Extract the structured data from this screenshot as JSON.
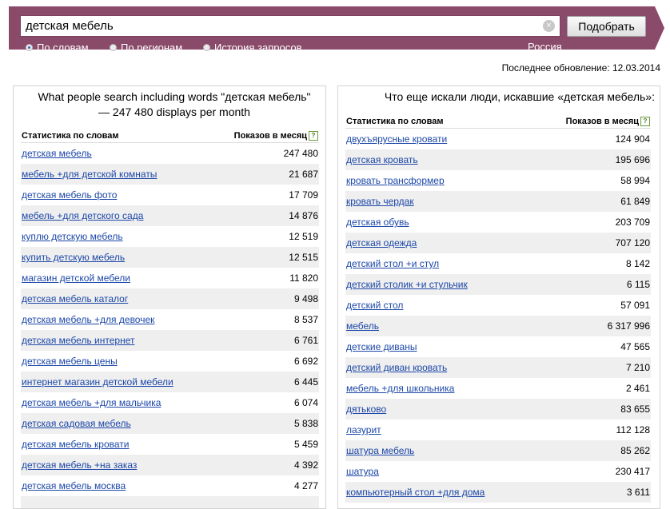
{
  "search": {
    "value": "детская мебель",
    "clear_label": "×",
    "submit_label": "Подобрать"
  },
  "modes": [
    {
      "label": "По словам",
      "checked": true
    },
    {
      "label": "По регионам",
      "checked": false
    },
    {
      "label": "История запросов",
      "checked": false
    }
  ],
  "region": "Россия",
  "updated": "Последнее обновление: 12.03.2014",
  "left_panel": {
    "title": "What people search including words \"детская мебель\" — 247 480 displays per month",
    "col_words": "Статистика по словам",
    "col_count": "Показов в месяц",
    "help": "?",
    "rows": [
      {
        "q": "детская мебель",
        "n": "247 480"
      },
      {
        "q": "мебель +для детской комнаты",
        "n": "21 687"
      },
      {
        "q": "детская мебель фото",
        "n": "17 709"
      },
      {
        "q": "мебель +для детского сада",
        "n": "14 876"
      },
      {
        "q": "куплю детскую мебель",
        "n": "12 519"
      },
      {
        "q": "купить детскую мебель",
        "n": "12 515"
      },
      {
        "q": "магазин детской мебели",
        "n": "11 820"
      },
      {
        "q": "детская мебель каталог",
        "n": "9 498"
      },
      {
        "q": "детская мебель +для девочек",
        "n": "8 537"
      },
      {
        "q": "детская мебель интернет",
        "n": "6 761"
      },
      {
        "q": "детская мебель цены",
        "n": "6 692"
      },
      {
        "q": "интернет магазин детской мебели",
        "n": "6 445"
      },
      {
        "q": "детская мебель +для мальчика",
        "n": "6 074"
      },
      {
        "q": "детская садовая мебель",
        "n": "5 838"
      },
      {
        "q": "детская мебель кровати",
        "n": "5 459"
      },
      {
        "q": "детская мебель +на заказ",
        "n": "4 392"
      },
      {
        "q": "детская мебель москва",
        "n": "4 277"
      },
      {
        "q": "",
        "n": ""
      }
    ]
  },
  "right_panel": {
    "title": "Что еще искали люди, искавшие «детская мебель»:",
    "col_words": "Статистика по словам",
    "col_count": "Показов в месяц",
    "help": "?",
    "rows": [
      {
        "q": "двухъярусные кровати",
        "n": "124 904"
      },
      {
        "q": "детская кровать",
        "n": "195 696"
      },
      {
        "q": "кровать трансформер",
        "n": "58 994"
      },
      {
        "q": "кровать чердак",
        "n": "61 849"
      },
      {
        "q": "детская обувь",
        "n": "203 709"
      },
      {
        "q": "детская одежда",
        "n": "707 120"
      },
      {
        "q": "детский стол +и стул",
        "n": "8 142"
      },
      {
        "q": "детский столик +и стульчик",
        "n": "6 115"
      },
      {
        "q": "детский стол",
        "n": "57 091"
      },
      {
        "q": "мебель",
        "n": "6 317 996"
      },
      {
        "q": "детские диваны",
        "n": "47 565"
      },
      {
        "q": "детский диван кровать",
        "n": "7 210"
      },
      {
        "q": "мебель +для школьника",
        "n": "2 461"
      },
      {
        "q": "дятьково",
        "n": "83 655"
      },
      {
        "q": "лазурит",
        "n": "112 128"
      },
      {
        "q": "шатура мебель",
        "n": "85 262"
      },
      {
        "q": "шатура",
        "n": "230 417"
      },
      {
        "q": "компьютерный стол +для дома",
        "n": "3 611"
      }
    ]
  }
}
